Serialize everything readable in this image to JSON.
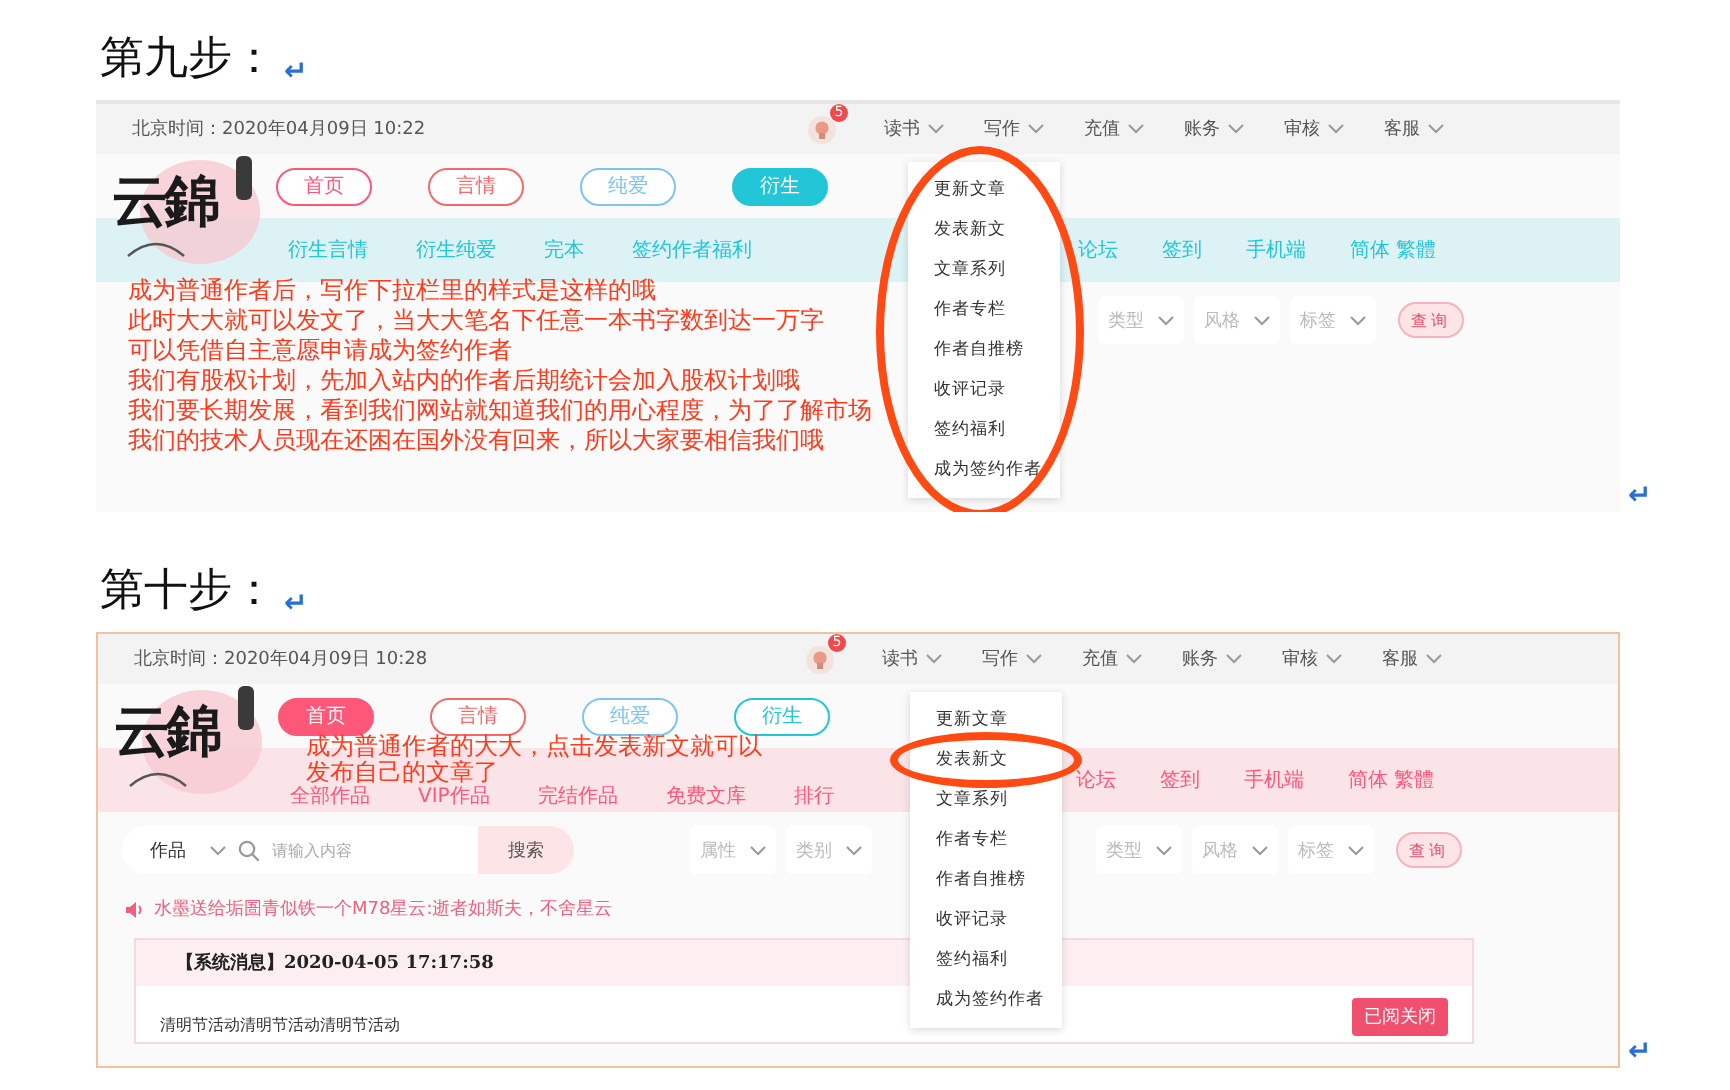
{
  "steps": [
    {
      "heading": "第九步：",
      "heading_mark": "↵",
      "end_mark": "↵",
      "screenshot": {
        "framed": false,
        "time": "北京时间：2020年04月09日 10:22",
        "badge": "5",
        "menu": [
          {
            "label": "读书"
          },
          {
            "label": "写作"
          },
          {
            "label": "充值"
          },
          {
            "label": "账务"
          },
          {
            "label": "审核"
          },
          {
            "label": "客服"
          }
        ],
        "logo_text": "云錦",
        "nav_pills": [
          {
            "label": "首页",
            "selected": false,
            "color": "#ff5777"
          },
          {
            "label": "言情",
            "selected": false,
            "color": "#f46a6a"
          },
          {
            "label": "纯爱",
            "selected": false,
            "color": "#7ec4ef"
          },
          {
            "label": "衍生",
            "selected": true,
            "color": "#22c6d6"
          }
        ],
        "subnav_left": [
          "衍生言情",
          "衍生纯爱",
          "完本",
          "签约作者福利"
        ],
        "subnav_right": [
          "论坛",
          "签到",
          "手机端",
          "简体 繁體"
        ],
        "filters": [
          "类型",
          "风格",
          "标签"
        ],
        "query_button": "查询",
        "dropdown": {
          "circled": true,
          "items": [
            {
              "label": "更新文章",
              "highlighted": false
            },
            {
              "label": "发表新文",
              "highlighted": false
            },
            {
              "label": "文章系列",
              "highlighted": false
            },
            {
              "label": "作者专栏",
              "highlighted": false
            },
            {
              "label": "作者自推榜",
              "highlighted": false
            },
            {
              "label": "收评记录",
              "highlighted": false
            },
            {
              "label": "签约福利",
              "highlighted": false
            },
            {
              "label": "成为签约作者",
              "highlighted": false
            }
          ]
        },
        "annotation": {
          "kind": "notes",
          "lines": [
            "成为普通作者后，写作下拉栏里的样式是这样的哦",
            "此时大大就可以发文了，当大大笔名下任意一本书字数到达一万字",
            "可以凭借自主意愿申请成为签约作者",
            "我们有股权计划，先加入站内的作者后期统计会加入股权计划哦",
            "我们要长期发展，看到我们网站就知道我们的用心程度，为了了解市场",
            "我们的技术人员现在还困在国外没有回来，所以大家要相信我们哦"
          ]
        }
      }
    },
    {
      "heading": "第十步：",
      "heading_mark": "↵",
      "end_mark": "↵",
      "screenshot": {
        "framed": true,
        "time": "北京时间：2020年04月09日 10:28",
        "badge": "5",
        "menu": [
          {
            "label": "读书"
          },
          {
            "label": "写作"
          },
          {
            "label": "充值"
          },
          {
            "label": "账务"
          },
          {
            "label": "审核"
          },
          {
            "label": "客服"
          }
        ],
        "logo_text": "云錦",
        "nav_pills": [
          {
            "label": "首页",
            "selected": true,
            "color": "#ff5777"
          },
          {
            "label": "言情",
            "selected": false,
            "color": "#f46a6a"
          },
          {
            "label": "纯爱",
            "selected": false,
            "color": "#7ec4ef"
          },
          {
            "label": "衍生",
            "selected": false,
            "color": "#22c6d6"
          }
        ],
        "subnav_left": [
          "全部作品",
          "VIP作品",
          "完结作品",
          "免费文库",
          "排行"
        ],
        "subnav_right": [
          "论坛",
          "签到",
          "手机端",
          "简体 繁體"
        ],
        "search": {
          "category": "作品",
          "placeholder": "请输入内容",
          "button": "搜索"
        },
        "filters_left": [
          "属性",
          "类别"
        ],
        "filters": [
          "类型",
          "风格",
          "标签"
        ],
        "query_button": "查询",
        "notice": "水墨送给垢圄青似铁一个M78星云:逝者如斯夫，不舍星云",
        "message": {
          "title": "【系统消息】2020-04-05 17:17:58",
          "body": "清明节活动清明节活动清明节活动",
          "button": "已阅关闭"
        },
        "dropdown": {
          "circled": false,
          "items": [
            {
              "label": "更新文章",
              "highlighted": false
            },
            {
              "label": "发表新文",
              "highlighted": true
            },
            {
              "label": "文章系列",
              "highlighted": false
            },
            {
              "label": "作者专栏",
              "highlighted": false
            },
            {
              "label": "作者自推榜",
              "highlighted": false
            },
            {
              "label": "收评记录",
              "highlighted": false
            },
            {
              "label": "签约福利",
              "highlighted": false
            },
            {
              "label": "成为签约作者",
              "highlighted": false
            }
          ]
        },
        "annotation": {
          "kind": "callout",
          "lines": [
            "成为普通作者的大大，点击发表新文就可以",
            "发布自己的文章了"
          ]
        }
      }
    }
  ]
}
